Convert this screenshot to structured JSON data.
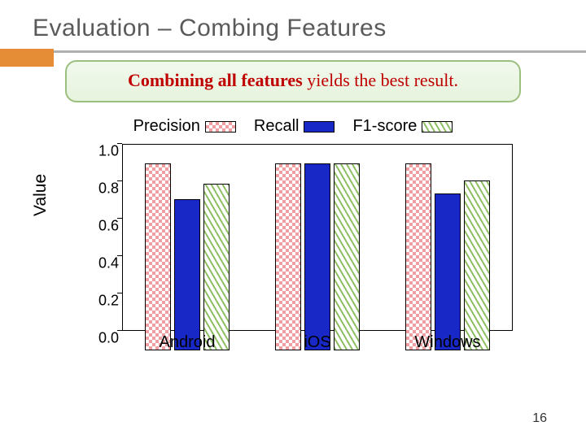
{
  "title": "Evaluation – Combing Features",
  "callout": {
    "bold": "Combining all features",
    "rest": " yields the best result."
  },
  "page_number": "16",
  "legend": {
    "precision": "Precision",
    "recall": "Recall",
    "f1": "F1-score"
  },
  "axis": {
    "ylabel": "Value",
    "yticks": [
      "0.0",
      "0.2",
      "0.4",
      "0.6",
      "0.8",
      "1.0"
    ]
  },
  "categories_labels": {
    "0": "Android",
    "1": "iOS",
    "2": "Windows"
  },
  "chart_data": {
    "type": "bar",
    "title": "",
    "xlabel": "",
    "ylabel": "Value",
    "ylim": [
      0.0,
      1.0
    ],
    "categories": [
      "Android",
      "iOS",
      "Windows"
    ],
    "series": [
      {
        "name": "Precision",
        "values": [
          1.0,
          1.0,
          1.0
        ]
      },
      {
        "name": "Recall",
        "values": [
          0.81,
          1.0,
          0.84
        ]
      },
      {
        "name": "F1-score",
        "values": [
          0.89,
          1.0,
          0.91
        ]
      }
    ],
    "legend_position": "top"
  }
}
